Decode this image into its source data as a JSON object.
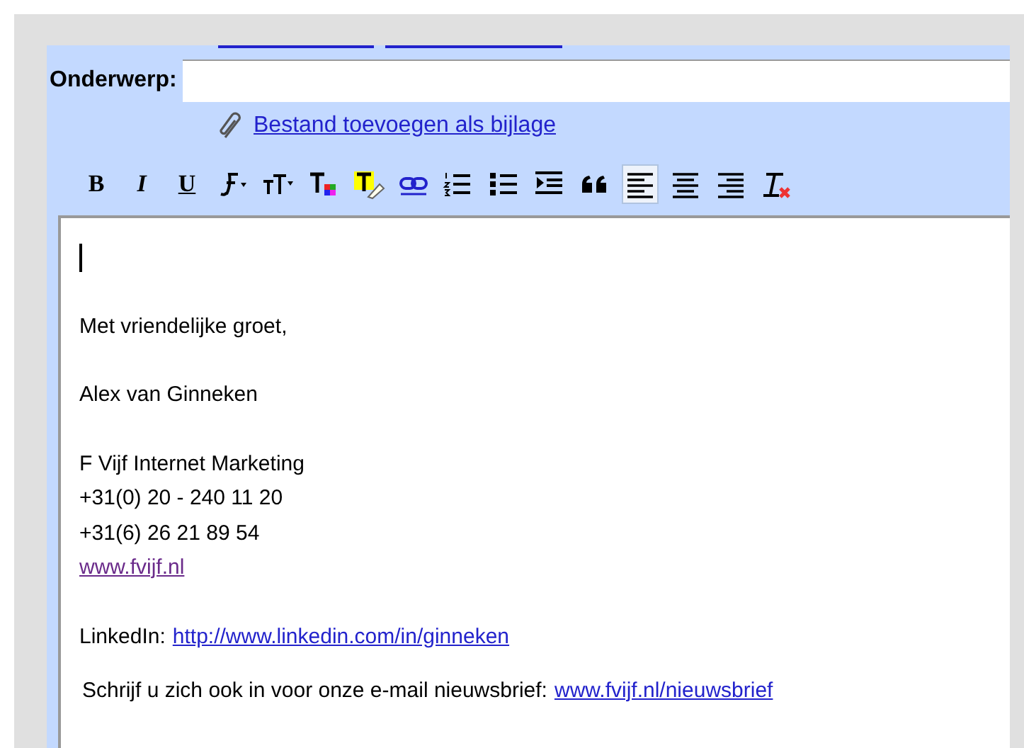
{
  "subject": {
    "label": "Onderwerp:"
  },
  "attachment_link": "Bestand toevoegen als bijlage",
  "toolbar": [
    {
      "kind": "bold",
      "label": "B",
      "selected": false
    },
    {
      "kind": "italic",
      "label": "I",
      "selected": false
    },
    {
      "kind": "underline",
      "label": "U",
      "selected": false
    },
    {
      "kind": "font",
      "selected": false
    },
    {
      "kind": "size",
      "selected": false
    },
    {
      "kind": "textcolor",
      "selected": false
    },
    {
      "kind": "highlight",
      "selected": false
    },
    {
      "kind": "link",
      "selected": false
    },
    {
      "kind": "numbered",
      "selected": false
    },
    {
      "kind": "bulleted",
      "selected": false
    },
    {
      "kind": "indent",
      "selected": false
    },
    {
      "kind": "quote",
      "selected": false
    },
    {
      "kind": "alignleft",
      "selected": true
    },
    {
      "kind": "aligncenter",
      "selected": false
    },
    {
      "kind": "alignright",
      "selected": false
    },
    {
      "kind": "clear",
      "selected": false
    }
  ],
  "body": [
    {
      "kind": "cursor"
    },
    {
      "kind": "gap"
    },
    {
      "kind": "text",
      "text": "Met vriendelijke groet,"
    },
    {
      "kind": "gap"
    },
    {
      "kind": "text",
      "text": "Alex van Ginneken"
    },
    {
      "kind": "gap"
    },
    {
      "kind": "text",
      "text": "F Vijf Internet Marketing"
    },
    {
      "kind": "text",
      "text": "+31(0) 20 - 240 11 20"
    },
    {
      "kind": "text",
      "text": "+31(6) 26 21 89 54"
    },
    {
      "kind": "link",
      "text": "www.fvijf.nl",
      "visited": true
    },
    {
      "kind": "gap"
    },
    {
      "kind": "labeled",
      "text": "LinkedIn:",
      "link": "http://www.linkedin.com/in/ginneken"
    },
    {
      "kind": "footer",
      "text": "Schrijf u zich ook in voor onze e-mail nieuwsbrief:",
      "link": "www.fvijf.nl/nieuwsbrief"
    }
  ]
}
